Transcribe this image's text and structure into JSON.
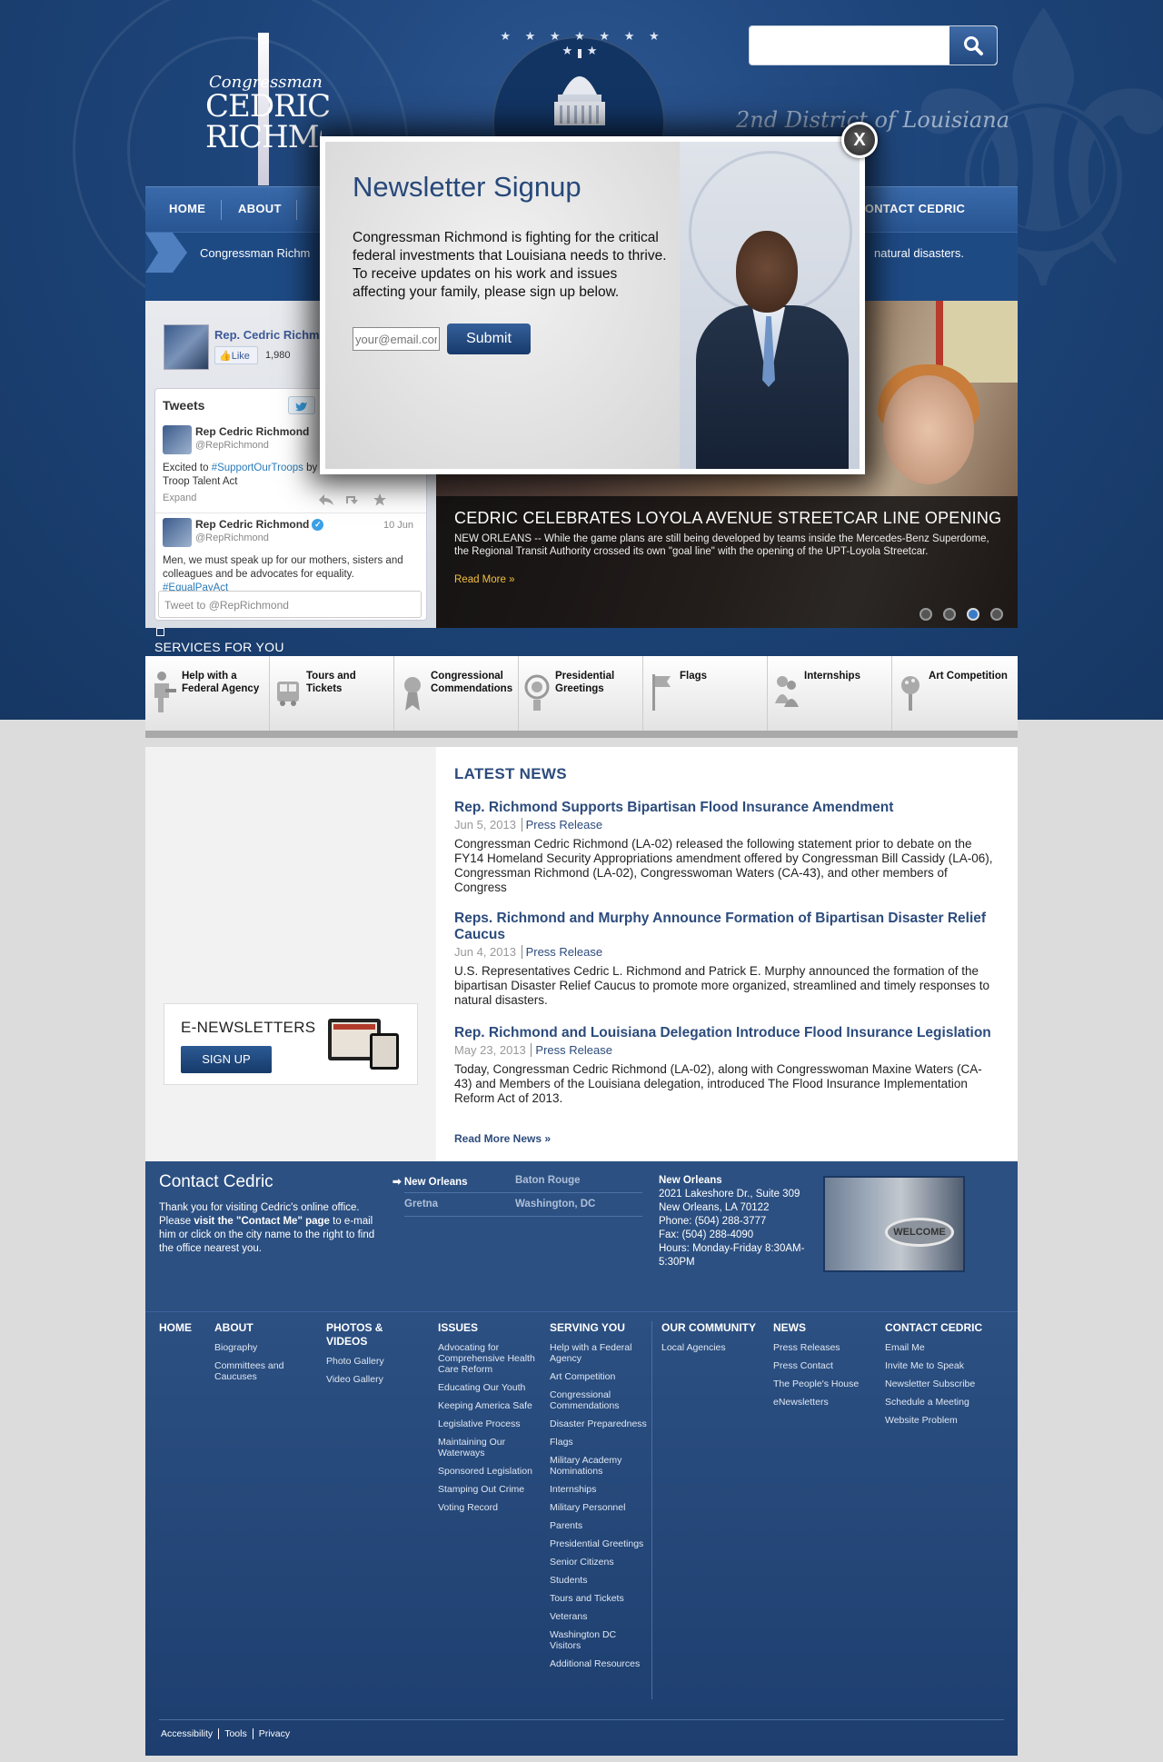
{
  "header": {
    "logo_small": "Congressman",
    "logo_line1": "CEDRIC",
    "logo_line2": "RICHMOND",
    "district": "2nd District of Louisiana",
    "search_placeholder": "",
    "capitol_stars": "★ ★ ★ ★ ★ ★ ★ ★ ★"
  },
  "nav": {
    "home": "HOME",
    "about": "ABOUT",
    "contact": "CONTACT CEDRIC"
  },
  "ticker": {
    "text_left": "Congressman Richm",
    "text_right": "natural disasters."
  },
  "facebook": {
    "name": "Rep. Cedric Richmond",
    "like": "Like",
    "count": "1,980"
  },
  "twitter": {
    "header": "Tweets",
    "tweets": [
      {
        "name": "Rep Cedric Richmond",
        "handle": "@RepRichmond",
        "date": "",
        "text_pre": "Excited to ",
        "link": "#SupportOurTroops",
        "text_post": " by cosponsoring the Troop Talent Act",
        "expand": "Expand"
      },
      {
        "name": "Rep Cedric Richmond",
        "handle": "@RepRichmond",
        "date": "10 Jun",
        "text": "Men, we must speak up for our mothers, sisters and colleagues and be advocates for equality.",
        "link": "#EqualPayAct"
      }
    ],
    "compose_placeholder": "Tweet to @RepRichmond"
  },
  "slider": {
    "title": "CEDRIC CELEBRATES LOYOLA AVENUE STREETCAR LINE OPENING",
    "body": "NEW ORLEANS -- While the game plans are still being developed by teams inside the Mercedes-Benz Superdome, the Regional Transit Authority crossed its own \"goal line\" with the opening of the UPT-Loyola Streetcar.",
    "more": "Read More »",
    "active_slide": 3,
    "slide_count": 4
  },
  "services": {
    "label": "SERVICES FOR YOU",
    "items": [
      {
        "label": "Help with a Federal Agency",
        "icon": "helping-hand-icon"
      },
      {
        "label": "Tours and Tickets",
        "icon": "bus-icon"
      },
      {
        "label": "Congressional Commendations",
        "icon": "medal-icon"
      },
      {
        "label": "Presidential Greetings",
        "icon": "presidential-seal-icon"
      },
      {
        "label": "Flags",
        "icon": "flag-icon"
      },
      {
        "label": "Internships",
        "icon": "people-icon"
      },
      {
        "label": "Art Competition",
        "icon": "palette-icon"
      }
    ]
  },
  "enewsletter": {
    "title": "E-NEWSLETTERS",
    "button": "SIGN UP"
  },
  "news": {
    "heading": "LATEST NEWS",
    "items": [
      {
        "title": "Rep. Richmond Supports Bipartisan Flood Insurance Amendment",
        "date": "Jun 5, 2013",
        "category": "Press Release",
        "body": "Congressman Cedric Richmond (LA-02) released the following statement prior to debate on the FY14 Homeland Security Appropriations amendment offered by Congressman Bill Cassidy (LA-06), Congressman Richmond (LA-02), Congresswoman Waters (CA-43), and other members of Congress"
      },
      {
        "title": "Reps. Richmond and Murphy Announce Formation of Bipartisan Disaster Relief Caucus",
        "date": "Jun 4, 2013",
        "category": "Press Release",
        "body": "U.S. Representatives Cedric L. Richmond and Patrick E. Murphy announced the formation of the bipartisan Disaster Relief Caucus to promote more organized, streamlined and timely responses to natural disasters."
      },
      {
        "title": "Rep. Richmond and Louisiana Delegation Introduce Flood Insurance Legislation",
        "date": "May 23, 2013",
        "category": "Press Release",
        "body": "Today, Congressman Cedric Richmond (LA-02), along with Congresswoman Maxine Waters (CA-43) and Members of the Louisiana delegation, introduced The Flood Insurance Implementation Reform Act of 2013."
      }
    ],
    "more": "Read More News »"
  },
  "contact": {
    "title": "Contact Cedric",
    "text_pre": "Thank you for visiting Cedric's online office. Please ",
    "text_bold": "visit the \"Contact Me\" page",
    "text_post": " to e-mail him or click on the city name to the right to find the office nearest you.",
    "cities": {
      "new_orleans": "New Orleans",
      "baton_rouge": "Baton Rouge",
      "gretna": "Gretna",
      "washington": "Washington, DC"
    },
    "address": {
      "title": "New Orleans",
      "line1": "2021 Lakeshore Dr., Suite 309",
      "line2": "New Orleans, LA 70122",
      "phone": "Phone: (504) 288-3777",
      "fax": "Fax: (504) 288-4090",
      "hours": "Hours: Monday-Friday 8:30AM-5:30PM"
    },
    "welcome_sign": "WELCOME"
  },
  "sitemap": {
    "home": "HOME",
    "columns": [
      {
        "head": "ABOUT",
        "links": [
          "Biography",
          "Committees and Caucuses"
        ]
      },
      {
        "head": "PHOTOS & VIDEOS",
        "links": [
          "Photo Gallery",
          "Video Gallery"
        ]
      },
      {
        "head": "ISSUES",
        "links": [
          "Advocating for Comprehensive Health Care Reform",
          "Educating Our Youth",
          "Keeping America Safe",
          "Legislative Process",
          "Maintaining Our Waterways",
          "Sponsored Legislation",
          "Stamping Out Crime",
          "Voting Record"
        ]
      },
      {
        "head": "SERVING YOU",
        "links": [
          "Help with a Federal Agency",
          "Art Competition",
          "Congressional Commendations",
          "Disaster Preparedness",
          "Flags",
          "Military Academy Nominations",
          "Internships",
          "Military Personnel",
          "Parents",
          "Presidential Greetings",
          "Senior Citizens",
          "Students",
          "Tours and Tickets",
          "Veterans",
          "Washington DC Visitors",
          "Additional Resources"
        ]
      },
      {
        "head": "OUR COMMUNITY",
        "links": [
          "Local Agencies"
        ]
      },
      {
        "head": "NEWS",
        "links": [
          "Press Releases",
          "Press Contact",
          "The People's House",
          "eNewsletters"
        ]
      },
      {
        "head": "CONTACT CEDRIC",
        "links": [
          "Email Me",
          "Invite Me to Speak",
          "Newsletter Subscribe",
          "Schedule a Meeting",
          "Website Problem"
        ]
      }
    ],
    "bottom": [
      "Accessibility",
      "Tools",
      "Privacy"
    ]
  },
  "modal": {
    "title": "Newsletter Signup",
    "text": "Congressman Richmond is fighting for the critical federal investments that Louisiana needs to thrive. To receive updates on his work and issues affecting your family, please sign up below.",
    "email_placeholder": "your@email.com",
    "submit": "Submit",
    "close": "X"
  }
}
